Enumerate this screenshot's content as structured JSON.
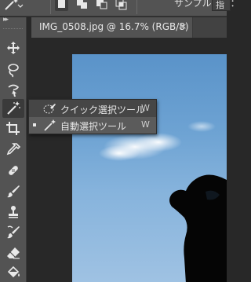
{
  "options_bar": {
    "active_tool_icon": "magic-wand-icon",
    "selection_modes": [
      "new-selection-icon",
      "add-to-selection-icon",
      "subtract-from-selection-icon",
      "intersect-selection-icon"
    ],
    "sample_size_label": "サンプル範囲：",
    "sample_size_value": "指"
  },
  "document": {
    "tab_title": "IMG_0508.jpg @ 16.7% (RGB/8)",
    "close_glyph": "×"
  },
  "toolbar": {
    "collapse_glyph": "▸▸",
    "tools": [
      {
        "name": "move-tool",
        "icon": "move-icon"
      },
      {
        "name": "marquee-tool",
        "icon": "lasso-icon"
      },
      {
        "name": "lasso-tool",
        "icon": "polygonal-lasso-icon"
      },
      {
        "name": "magic-wand-tool",
        "icon": "magic-wand-icon",
        "active": true
      },
      {
        "name": "crop-tool",
        "icon": "crop-icon"
      },
      {
        "name": "eyedropper-tool",
        "icon": "eyedropper-icon"
      },
      {
        "name": "healing-brush-tool",
        "icon": "bandage-icon"
      },
      {
        "name": "brush-tool",
        "icon": "brush-icon"
      },
      {
        "name": "clone-stamp-tool",
        "icon": "stamp-icon"
      },
      {
        "name": "history-brush-tool",
        "icon": "history-brush-icon"
      },
      {
        "name": "eraser-tool",
        "icon": "eraser-icon"
      },
      {
        "name": "paint-bucket-tool",
        "icon": "bucket-icon"
      }
    ]
  },
  "flyout": {
    "items": [
      {
        "label": "クイック選択ツール",
        "shortcut": "W",
        "icon": "quick-selection-icon",
        "selected": false
      },
      {
        "label": "自動選択ツール",
        "shortcut": "W",
        "icon": "magic-wand-icon",
        "selected": true
      }
    ]
  },
  "colors": {
    "panel": "#535353",
    "workspace": "#282828",
    "flyout": "#464646",
    "sky": "#6ea3d3"
  }
}
